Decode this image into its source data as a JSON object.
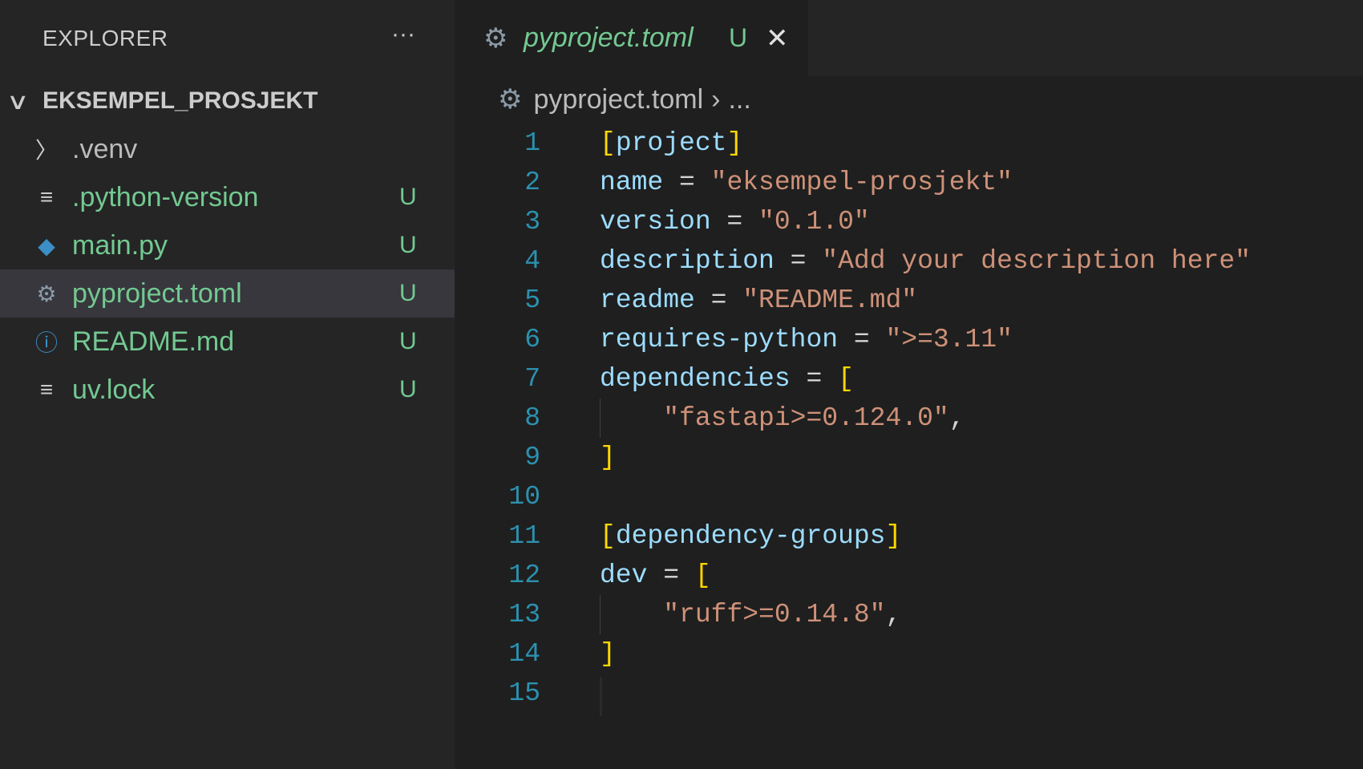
{
  "sidebar": {
    "title": "EXPLORER",
    "more": "···",
    "project": "EKSEMPEL_PROSJEKT",
    "items": [
      {
        "label": ".venv",
        "icon": "chevron-right-icon",
        "badge": "",
        "color": "#cccccc"
      },
      {
        "label": ".python-version",
        "icon": "lines-icon",
        "badge": "U",
        "color": "#73c991"
      },
      {
        "label": "main.py",
        "icon": "python-icon",
        "badge": "U",
        "color": "#73c991"
      },
      {
        "label": "pyproject.toml",
        "icon": "gear-icon",
        "badge": "U",
        "color": "#73c991",
        "selected": true
      },
      {
        "label": "README.md",
        "icon": "info-icon",
        "badge": "U",
        "color": "#73c991"
      },
      {
        "label": "uv.lock",
        "icon": "lines-icon",
        "badge": "U",
        "color": "#73c991"
      }
    ]
  },
  "tab": {
    "label": "pyproject.toml",
    "badge": "U",
    "close": "✕"
  },
  "breadcrumb": {
    "file": "pyproject.toml",
    "sep": "›",
    "rest": "..."
  },
  "code": {
    "lines": [
      {
        "n": "1"
      },
      {
        "n": "2"
      },
      {
        "n": "3"
      },
      {
        "n": "4"
      },
      {
        "n": "5"
      },
      {
        "n": "6"
      },
      {
        "n": "7"
      },
      {
        "n": "8"
      },
      {
        "n": "9"
      },
      {
        "n": "10"
      },
      {
        "n": "11"
      },
      {
        "n": "12"
      },
      {
        "n": "13"
      },
      {
        "n": "14"
      },
      {
        "n": "15"
      }
    ],
    "tokens": {
      "l1": "project",
      "l2k": "name",
      "l2s": "\"eksempel-prosjekt\"",
      "l3k": "version",
      "l3s": "\"0.1.0\"",
      "l4k": "description",
      "l4s": "\"Add your description here\"",
      "l5k": "readme",
      "l5s": "\"README.md\"",
      "l6k": "requires-python",
      "l6s": "\">=3.11\"",
      "l7k": "dependencies",
      "l8s": "\"fastapi>=0.124.0\"",
      "l11": "dependency-groups",
      "l12k": "dev",
      "l13s": "\"ruff>=0.14.8\""
    }
  }
}
